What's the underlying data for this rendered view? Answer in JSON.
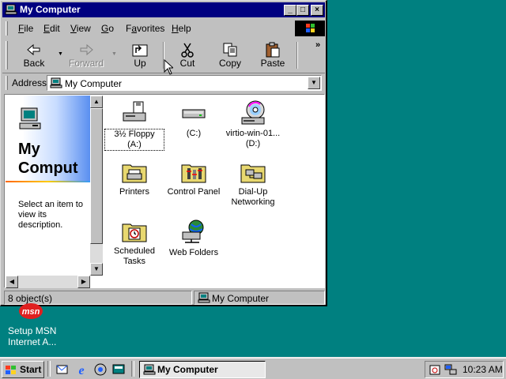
{
  "window": {
    "title": "My Computer",
    "controls": {
      "minimize": "_",
      "maximize": "□",
      "close": "×"
    }
  },
  "menu": {
    "items": [
      {
        "label": "File",
        "underline": "F"
      },
      {
        "label": "Edit",
        "underline": "E"
      },
      {
        "label": "View",
        "underline": "V"
      },
      {
        "label": "Go",
        "underline": "G"
      },
      {
        "label": "Favorites",
        "underline": "a"
      },
      {
        "label": "Help",
        "underline": "H"
      }
    ]
  },
  "toolbar": {
    "back": "Back",
    "forward": "Forward",
    "up": "Up",
    "cut": "Cut",
    "copy": "Copy",
    "paste": "Paste",
    "more": "»"
  },
  "address": {
    "label": "Address",
    "value": "My Computer"
  },
  "left_pane": {
    "title_line1": "My",
    "title_line2": "Comput",
    "description": "Select an item to view its description."
  },
  "items": [
    {
      "label": "3½ Floppy (A:)",
      "icon": "floppy-drive-icon",
      "selected": true
    },
    {
      "label": "(C:)",
      "icon": "hard-drive-icon"
    },
    {
      "label": "virtio-win-01... (D:)",
      "icon": "cd-drive-icon"
    },
    {
      "label": "Printers",
      "icon": "printers-folder-icon"
    },
    {
      "label": "Control Panel",
      "icon": "control-panel-folder-icon"
    },
    {
      "label": "Dial-Up Networking",
      "icon": "dial-up-networking-folder-icon"
    },
    {
      "label": "Scheduled Tasks",
      "icon": "scheduled-tasks-folder-icon"
    },
    {
      "label": "Web Folders",
      "icon": "web-folders-icon"
    }
  ],
  "status": {
    "count": "8 object(s)",
    "location": "My Computer"
  },
  "desktop": {
    "msn_badge": "msn",
    "msn_label_line1": "Setup MSN",
    "msn_label_line2": "Internet A..."
  },
  "taskbar": {
    "start": "Start",
    "task": "My Computer",
    "clock": "10:23 AM"
  },
  "colors": {
    "desktop": "#008080",
    "titlebar": "#000080",
    "face": "#c0c0c0"
  }
}
